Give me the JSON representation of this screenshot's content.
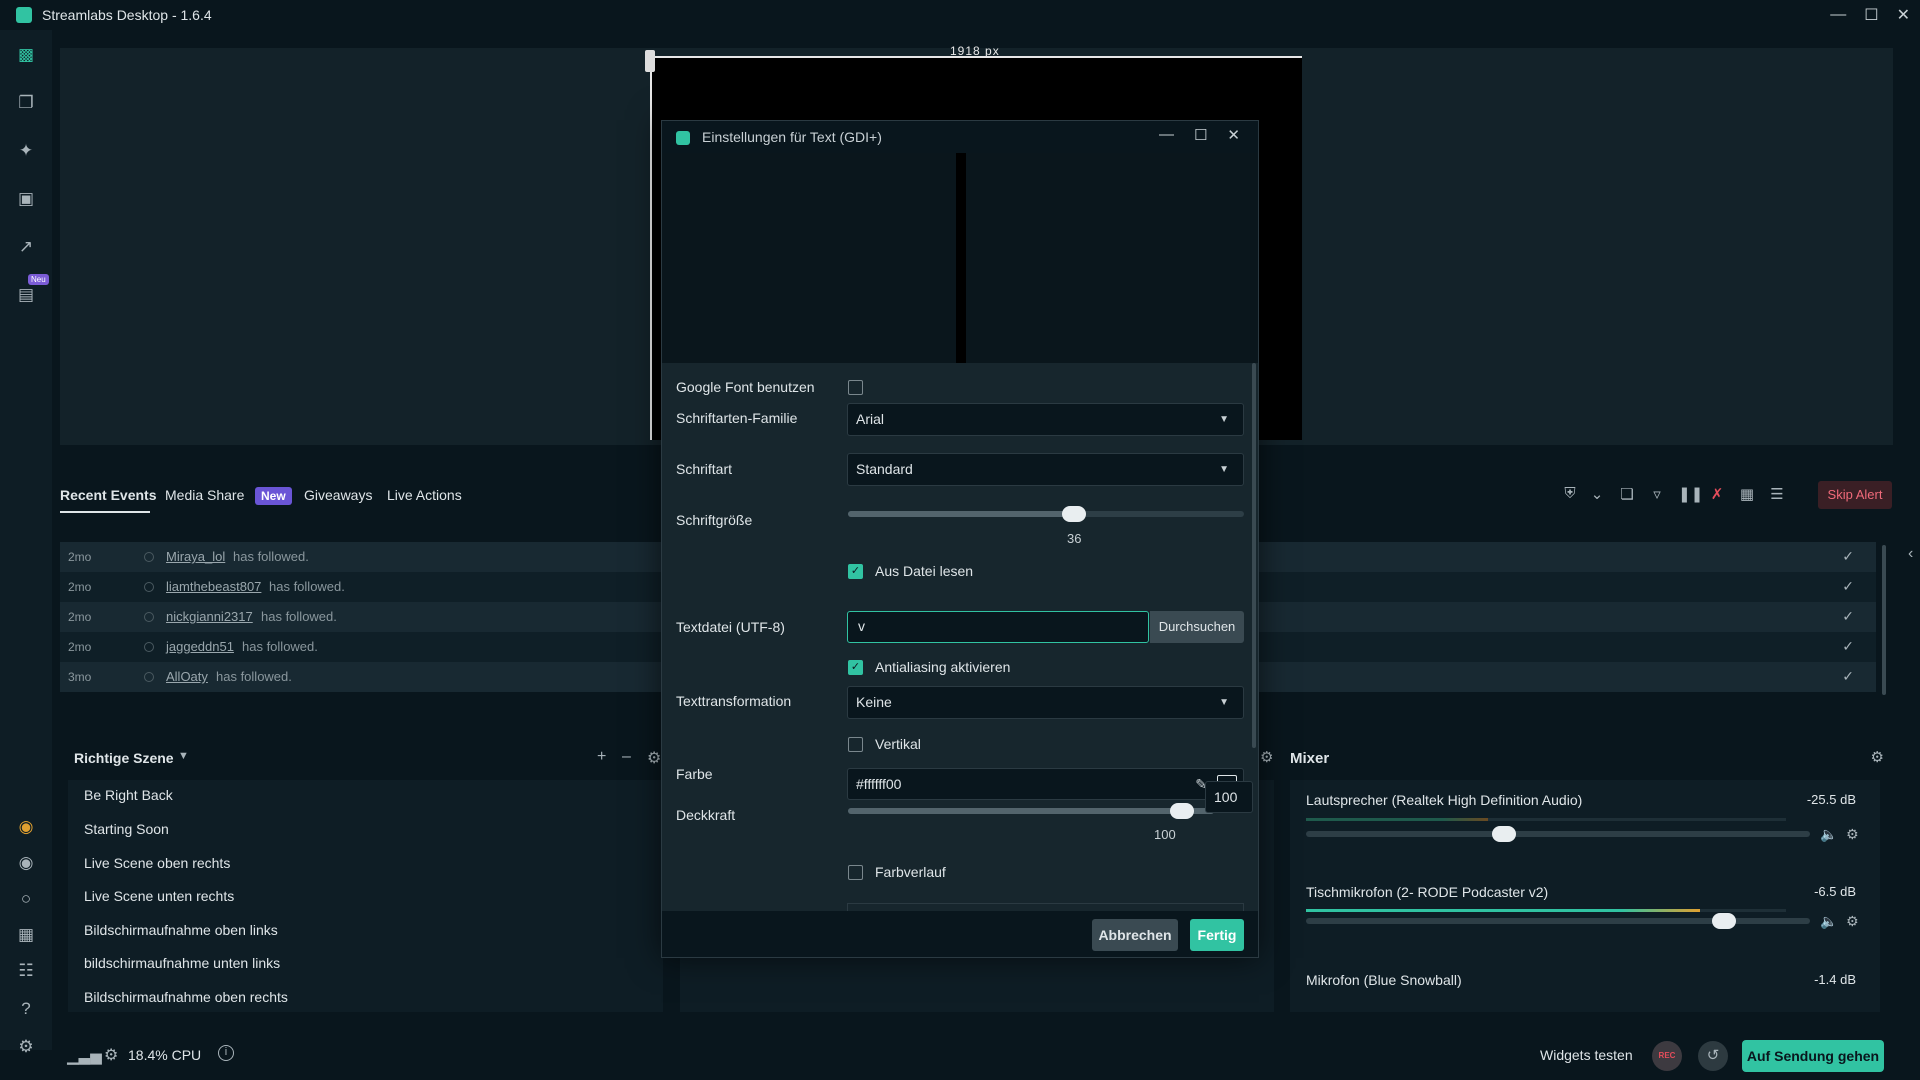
{
  "app": {
    "title": "Streamlabs Desktop - 1.6.4",
    "accent": "#31c3a2"
  },
  "window_controls": [
    "minimize-icon",
    "maximize-icon",
    "close-icon"
  ],
  "leftnav": {
    "icons": [
      "editor-icon",
      "themes-icon",
      "tools-icon",
      "store-icon",
      "analytics-icon",
      "highlighter-icon",
      "ultra-icon",
      "alert-icon",
      "chat-icon",
      "layout-icon",
      "library-icon",
      "help-icon",
      "settings-icon"
    ],
    "badge": "Neu"
  },
  "preview": {
    "ruler_label": "1918 px"
  },
  "events": {
    "tabs": {
      "recent": "Recent Events",
      "media": "Media Share",
      "new_badge": "New",
      "giveaways": "Giveaways",
      "live": "Live Actions"
    },
    "skip_alert": "Skip Alert",
    "rows": [
      {
        "time": "2mo",
        "user": "Miraya_lol",
        "text": "has followed."
      },
      {
        "time": "2mo",
        "user": "liamthebeast807",
        "text": "has followed."
      },
      {
        "time": "2mo",
        "user": "nickgianni2317",
        "text": "has followed."
      },
      {
        "time": "2mo",
        "user": "jaggeddn51",
        "text": "has followed."
      },
      {
        "time": "3mo",
        "user": "AllOaty",
        "text": "has followed."
      }
    ]
  },
  "scenes": {
    "title": "Richtige Szene",
    "items": [
      "Be Right Back",
      "Starting Soon",
      "Live Scene oben rechts",
      "Live Scene unten rechts",
      "Bildschirmaufnahme oben links",
      "bildschirmaufnahme unten links",
      "Bildschirmaufnahme oben rechts"
    ]
  },
  "mixer": {
    "title": "Mixer",
    "channels": [
      {
        "name": "Lautsprecher (Realtek High Definition Audio)",
        "db": "-25.5 dB",
        "level": 0.38
      },
      {
        "name": "Tischmikrofon (2- RODE Podcaster v2)",
        "db": "-6.5 dB",
        "level": 0.82
      },
      {
        "name": "Mikrofon (Blue Snowball)",
        "db": "-1.4 dB"
      }
    ]
  },
  "status": {
    "cpu": "18.4% CPU",
    "widgets_test": "Widgets testen",
    "rec": "REC",
    "go_live": "Auf Sendung gehen"
  },
  "dialog": {
    "title": "Einstellungen für Text (GDI+)",
    "google_font_label": "Google Font benutzen",
    "google_font_checked": false,
    "font_family_label": "Schriftarten-Familie",
    "font_family_value": "Arial",
    "font_style_label": "Schriftart",
    "font_style_value": "Standard",
    "font_size_label": "Schriftgröße",
    "font_size_value": "36",
    "font_size_fraction": 0.57,
    "read_file_label": "Aus Datei lesen",
    "read_file_checked": true,
    "text_file_label": "Textdatei (UTF-8)",
    "text_file_value": "v",
    "browse_label": "Durchsuchen",
    "antialiasing_label": "Antialiasing aktivieren",
    "antialiasing_checked": true,
    "transform_label": "Texttransformation",
    "transform_value": "Keine",
    "vertical_label": "Vertikal",
    "vertical_checked": false,
    "color_label": "Farbe",
    "color_value": "#ffffff00",
    "opacity_label": "Deckkraft",
    "opacity_value": "100",
    "opacity_box_value": "100",
    "gradient_label": "Farbverlauf",
    "gradient_checked": false,
    "cancel_label": "Abbrechen",
    "done_label": "Fertig"
  }
}
